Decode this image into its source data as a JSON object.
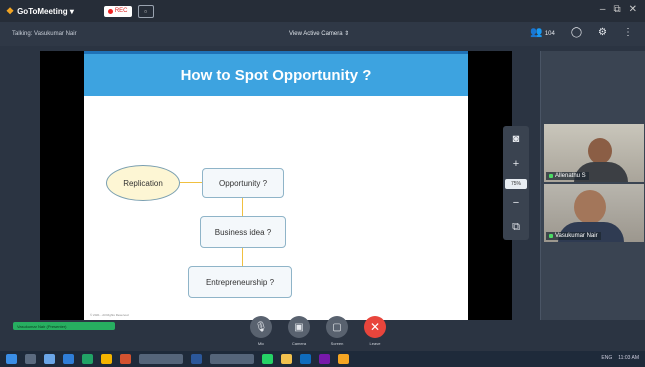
{
  "titlebar": {
    "app_logo": "❖",
    "app_name": "GoToMeeting ▾",
    "rec_label": "REC",
    "win_min": "–",
    "win_restore": "⧉",
    "win_close": "✕"
  },
  "infobar": {
    "talking": "Talking: Vasukumar Nair",
    "view_camera": "View Active Camera  ⇕",
    "attendee_count": "104"
  },
  "slide": {
    "title": "How to Spot Opportunity ?",
    "oval": "Replication",
    "box1": "Opportunity ?",
    "box2": "Business idea ?",
    "box3": "Entrepreneurship ?",
    "footer": "© 2021 - All Rights Reserved"
  },
  "zoom": {
    "camera_icon": "◙",
    "plus": "+",
    "level": "75%",
    "minus": "−",
    "fit_icon": "⧉"
  },
  "participants": [
    {
      "name": "Allenathu S"
    },
    {
      "name": "Vasukumar Nair"
    }
  ],
  "status_pill": "Vasukumar Nair (Presenter)",
  "controls": [
    {
      "label": "Mic",
      "icon": "🎙"
    },
    {
      "label": "Camera",
      "icon": "▣"
    },
    {
      "label": "Screen",
      "icon": "▢"
    },
    {
      "label": "Leave",
      "icon": "✕"
    }
  ],
  "tray": {
    "time": "11:03 AM",
    "date": "ENG"
  },
  "colors": {
    "accent_blue": "#3da3e0",
    "leave_red": "#e8453c",
    "status_green": "#27ae60",
    "connector_yellow": "#f0c040"
  }
}
